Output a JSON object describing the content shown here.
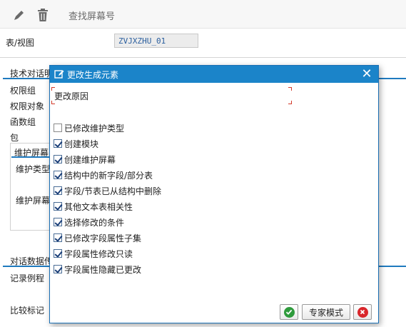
{
  "toolbar": {
    "edit_icon": "pencil-icon",
    "delete_icon": "trash-icon",
    "find_screen_label": "查找屏幕号"
  },
  "background": {
    "table_view_label": "表/视图",
    "table_view_value": "ZVJXZHU_01",
    "tech_dialog_label": "技术对话明",
    "auth_group_label": "权限组",
    "auth_object_label": "权限对象",
    "function_group_label": "函数组",
    "package_label": "包",
    "maint_screen_label": "维护屏幕",
    "maint_type_label": "维护类型",
    "maint_screen_label2": "维护屏幕",
    "dialog_data_label": "对话数据传",
    "record_routine_label": "记录例程",
    "compare_flag_label": "比较标记"
  },
  "dialog": {
    "title": "更改生成元素",
    "title_icon": "edit-window-icon",
    "close_icon": "close-icon",
    "reason_label": "更改原因",
    "options": [
      {
        "label": "已修改维护类型",
        "checked": false
      },
      {
        "label": "创建模块",
        "checked": true
      },
      {
        "label": "创建维护屏幕",
        "checked": true
      },
      {
        "label": "结构中的新字段/部分表",
        "checked": true
      },
      {
        "label": "字段/节表已从结构中删除",
        "checked": true
      },
      {
        "label": "其他文本表相关性",
        "checked": true
      },
      {
        "label": "选择修改的条件",
        "checked": true
      },
      {
        "label": "已修改字段属性子集",
        "checked": true
      },
      {
        "label": "字段属性修改只读",
        "checked": true
      },
      {
        "label": "字段属性隐藏已更改",
        "checked": true
      }
    ],
    "buttons": {
      "ok_icon": "check-icon",
      "expert_label": "专家模式",
      "cancel_icon": "cancel-icon"
    },
    "colors": {
      "title_bar": "#1b84c9",
      "ok_green": "#2e9b3c",
      "cancel_red": "#d9262b"
    }
  }
}
